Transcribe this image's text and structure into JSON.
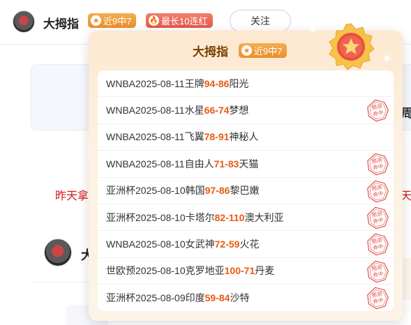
{
  "author": {
    "name": "大拇指",
    "streak_badge": "近9中7",
    "max_badge": "最长10连红",
    "follow_label": "关注"
  },
  "background": {
    "right_char": "周",
    "red_text_left": "昨天拿",
    "red_text_right": "天",
    "second_author_initial": "大"
  },
  "popup": {
    "title": "大拇指",
    "badge": "近9中7",
    "stamp_text_line1": "预测",
    "stamp_text_line2": "命中",
    "records": [
      {
        "league": "WNBA",
        "date": "2025-08-11",
        "home": "王牌",
        "home_score": "94",
        "away_score": "86",
        "away": "阳光",
        "hit": false
      },
      {
        "league": "WNBA",
        "date": "2025-08-11",
        "home": "水星",
        "home_score": "66",
        "away_score": "74",
        "away": "梦想",
        "hit": true
      },
      {
        "league": "WNBA",
        "date": "2025-08-11",
        "home": "飞翼",
        "home_score": "78",
        "away_score": "91",
        "away": "神秘人",
        "hit": false
      },
      {
        "league": "WNBA",
        "date": "2025-08-11",
        "home": "自由人",
        "home_score": "71",
        "away_score": "83",
        "away": "天猫",
        "hit": true
      },
      {
        "league": "亚洲杯",
        "date": "2025-08-10",
        "home": "韩国",
        "home_score": "97",
        "away_score": "86",
        "away": "黎巴嫩",
        "hit": true
      },
      {
        "league": "亚洲杯",
        "date": "2025-08-10",
        "home": "卡塔尔",
        "home_score": "82",
        "away_score": "110",
        "away": "澳大利亚",
        "hit": true
      },
      {
        "league": "WNBA",
        "date": "2025-08-10",
        "home": "女武神",
        "home_score": "72",
        "away_score": "59",
        "away": "火花",
        "hit": true
      },
      {
        "league": "世欧预",
        "date": "2025-08-10",
        "home": "克罗地亚",
        "home_score": "100",
        "away_score": "71",
        "away": "丹麦",
        "hit": true
      },
      {
        "league": "亚洲杯",
        "date": "2025-08-09",
        "home": "印度",
        "home_score": "59",
        "away_score": "84",
        "away": "沙特",
        "hit": true
      }
    ]
  },
  "colors": {
    "score": "#e85a12",
    "streak_badge": "#ec8e2d",
    "max_badge": "#e35a4b",
    "title": "#7a3e00",
    "stamp": "#e0504a"
  },
  "icons": [
    "avatar",
    "star-icon",
    "flame-icon",
    "medal-icon",
    "sparkle-icon",
    "hit-stamp-icon"
  ]
}
